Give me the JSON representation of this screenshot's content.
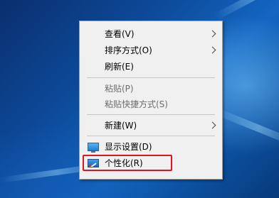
{
  "menu": {
    "items": [
      {
        "label": "查看(V)",
        "has_submenu": true,
        "disabled": false
      },
      {
        "label": "排序方式(O)",
        "has_submenu": true,
        "disabled": false
      },
      {
        "label": "刷新(E)",
        "has_submenu": false,
        "disabled": false
      },
      {
        "label": "粘贴(P)",
        "has_submenu": false,
        "disabled": true
      },
      {
        "label": "粘贴快捷方式(S)",
        "has_submenu": false,
        "disabled": true
      },
      {
        "label": "新建(W)",
        "has_submenu": true,
        "disabled": false
      },
      {
        "label": "显示设置(D)",
        "has_submenu": false,
        "disabled": false,
        "icon": "display-settings-icon"
      },
      {
        "label": "个性化(R)",
        "has_submenu": false,
        "disabled": false,
        "icon": "personalize-icon"
      }
    ]
  },
  "highlight": {
    "target": "个性化(R)",
    "color": "#e0141e"
  },
  "colors": {
    "menu_background": "#f0f0f0",
    "disabled_text": "#6d6d6d",
    "desktop_blue": "#0d4a9a"
  }
}
